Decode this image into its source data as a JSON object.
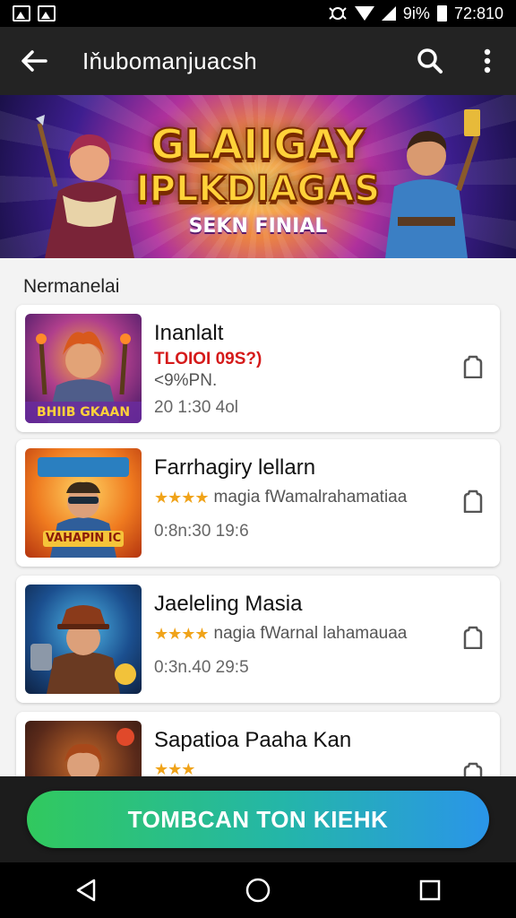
{
  "status_bar": {
    "battery_text": "9i%",
    "time": "72:810",
    "icons": [
      "image-icon",
      "image-icon",
      "vibrate-icon",
      "wifi-icon",
      "signal-icon",
      "battery-icon"
    ]
  },
  "app_bar": {
    "title": "Iňubomanjuacsh",
    "back_icon": "arrow-left-icon",
    "search_icon": "search-icon",
    "menu_icon": "more-vert-icon"
  },
  "banner": {
    "title_line1": "GLAIIGAY",
    "title_line2": "IPLKDIAGAS",
    "subtitle": "SEKN FINIAL"
  },
  "section": {
    "label": "Nermanelai"
  },
  "items": [
    {
      "title": "Inanlalt",
      "promo": "TLOIOI 09S?)",
      "meta": "<9%PN.",
      "time": "20 1:30 4ol",
      "thumb_caption": "BHIIB GKAAN",
      "colors": [
        "#4b1e7a",
        "#d36a1a"
      ]
    },
    {
      "title": "Farrhagiry lellarn",
      "stars": "★★★★",
      "meta": "magia fWamalrahamatiaa",
      "time": "0:8n:30 19:6",
      "thumb_caption": "VAHAPIN IC",
      "colors": [
        "#e46a1e",
        "#f5b93a"
      ]
    },
    {
      "title": "Jaeleling Masia",
      "stars": "★★★★",
      "meta": "nagia fWarnal lahamauaa",
      "time": "0:3n.40 29:5",
      "thumb_caption": "",
      "colors": [
        "#1b4f8f",
        "#6a3a22"
      ]
    },
    {
      "title": "Sapatioa Paaha Kan",
      "stars": "★★★",
      "meta": "",
      "time": "",
      "thumb_caption": "",
      "colors": [
        "#3a2a22",
        "#a55a2a"
      ]
    }
  ],
  "cta": {
    "label": "TOMBCAN TON KIЕHK"
  },
  "nav": {
    "back_icon": "triangle-back-icon",
    "home_icon": "circle-home-icon",
    "recents_icon": "square-recents-icon"
  }
}
